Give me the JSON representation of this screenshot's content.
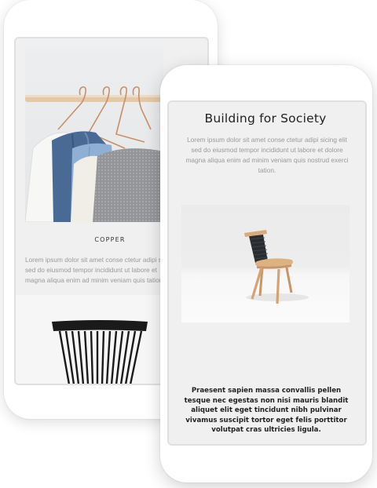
{
  "back_phone": {
    "photo_icon": "clothes-hanger-photo",
    "caption": "COPPER",
    "body": "Lorem ipsum dolor sit amet conse ctetur adipi s\nsed do eiusmod tempor incididunt ut labore et\nmagna aliqua enim ad minim veniam quis tation",
    "chair_icon": "spindle-chair-back"
  },
  "front_phone": {
    "title": "Building for Society",
    "intro": "Lorem ipsum dolor sit amet conse ctetur adipi sicing elit sed do eiusmod tempor incididunt ut labore et dolore magna aliqua enim ad minim veniam quis nostrud exerci tation.",
    "photo_icon": "wooden-chair-photo",
    "bold_text": "Praesent sapien massa convallis pellen tesque nec egestas non nisi mauris blandit aliquet elit eget tincidunt nibh pulvinar vivamus suscipit tortor eget felis porttitor volutpat cras ultricies ligula."
  },
  "colors": {
    "screen_bg": "#f0f0f0",
    "text_muted": "#9a9a9a",
    "text_dark": "#222222",
    "copper": "#c8906a",
    "wood": "#d8a97a"
  }
}
